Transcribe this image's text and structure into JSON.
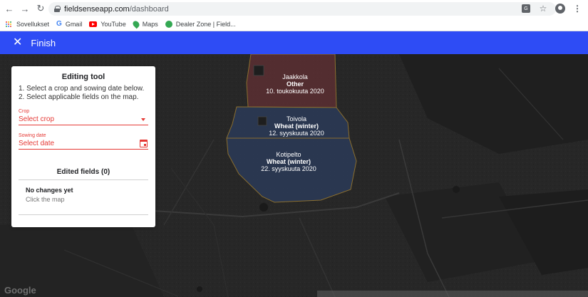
{
  "browser": {
    "url_domain": "fieldsenseapp.com",
    "url_path": "/dashboard",
    "bookmarks": [
      {
        "label": "Sovellukset",
        "icon": "apps-icon"
      },
      {
        "label": "Gmail",
        "icon": "google-icon"
      },
      {
        "label": "YouTube",
        "icon": "youtube-icon"
      },
      {
        "label": "Maps",
        "icon": "maps-icon"
      },
      {
        "label": "Dealer Zone | Field...",
        "icon": "dealer-zone-icon"
      }
    ]
  },
  "appbar": {
    "close_glyph": "✕",
    "title": "Finish",
    "color": "#2e4cf5"
  },
  "map": {
    "google_label": "Google",
    "fields": [
      {
        "name": "Jaakkola",
        "crop": "Other",
        "date": "10. toukokuuta 2020",
        "color": "#5c2f33"
      },
      {
        "name": "Toivola",
        "crop": "Wheat (winter)",
        "date": "12. syyskuuta 2020",
        "color": "#2b3a55"
      },
      {
        "name": "Kotipelto",
        "crop": "Wheat (winter)",
        "date": "22. syyskuuta 2020",
        "color": "#2b3a55"
      }
    ]
  },
  "panel": {
    "title": "Editing tool",
    "instruction_1": "1. Select a crop and sowing date below.",
    "instruction_2": "2. Select applicable fields on the map.",
    "crop_label": "Crop",
    "crop_value": "Select crop",
    "sowing_label": "Sowing date",
    "sowing_value": "Select date",
    "edited_title": "Edited fields (0)",
    "no_changes": "No changes yet",
    "click_hint": "Click the map",
    "error_color": "#e53935"
  }
}
